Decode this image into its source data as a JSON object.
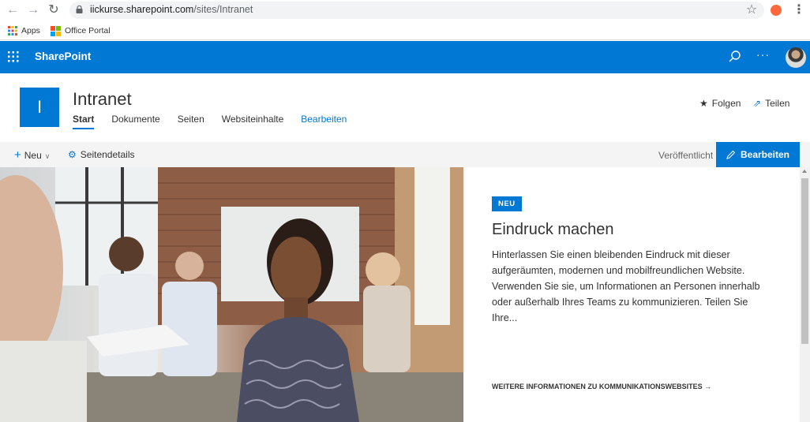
{
  "browser": {
    "url_host": "iickurse.sharepoint.com",
    "url_path": "/sites/Intranet",
    "bookmarks": [
      {
        "label": "Apps",
        "icon": "apps-grid-icon"
      },
      {
        "label": "Office Portal",
        "icon": "office-logo-icon"
      }
    ]
  },
  "suitebar": {
    "brand": "SharePoint",
    "more": "···",
    "color": "#0078d4"
  },
  "site": {
    "logo_letter": "I",
    "title": "Intranet",
    "nav": [
      {
        "label": "Start",
        "active": true
      },
      {
        "label": "Dokumente"
      },
      {
        "label": "Seiten"
      },
      {
        "label": "Websiteinhalte"
      },
      {
        "label": "Bearbeiten",
        "edit": true
      }
    ],
    "follow_label": "Folgen",
    "share_label": "Teilen"
  },
  "commandbar": {
    "new_label": "Neu",
    "details_label": "Seitendetails",
    "status": "Veröffentlicht",
    "edit_label": "Bearbeiten"
  },
  "hero": {
    "badge": "NEU",
    "title": "Eindruck machen",
    "text": "Hinterlassen Sie einen bleibenden Eindruck mit dieser aufgeräumten, modernen und mobilfreundlichen Website. Verwenden Sie sie, um Informationen an Personen innerhalb oder außerhalb Ihres Teams zu kommunizieren. Teilen Sie Ihre...",
    "link": "WEITERE INFORMATIONEN ZU KOMMUNIKATIONSWEBSITES →"
  }
}
